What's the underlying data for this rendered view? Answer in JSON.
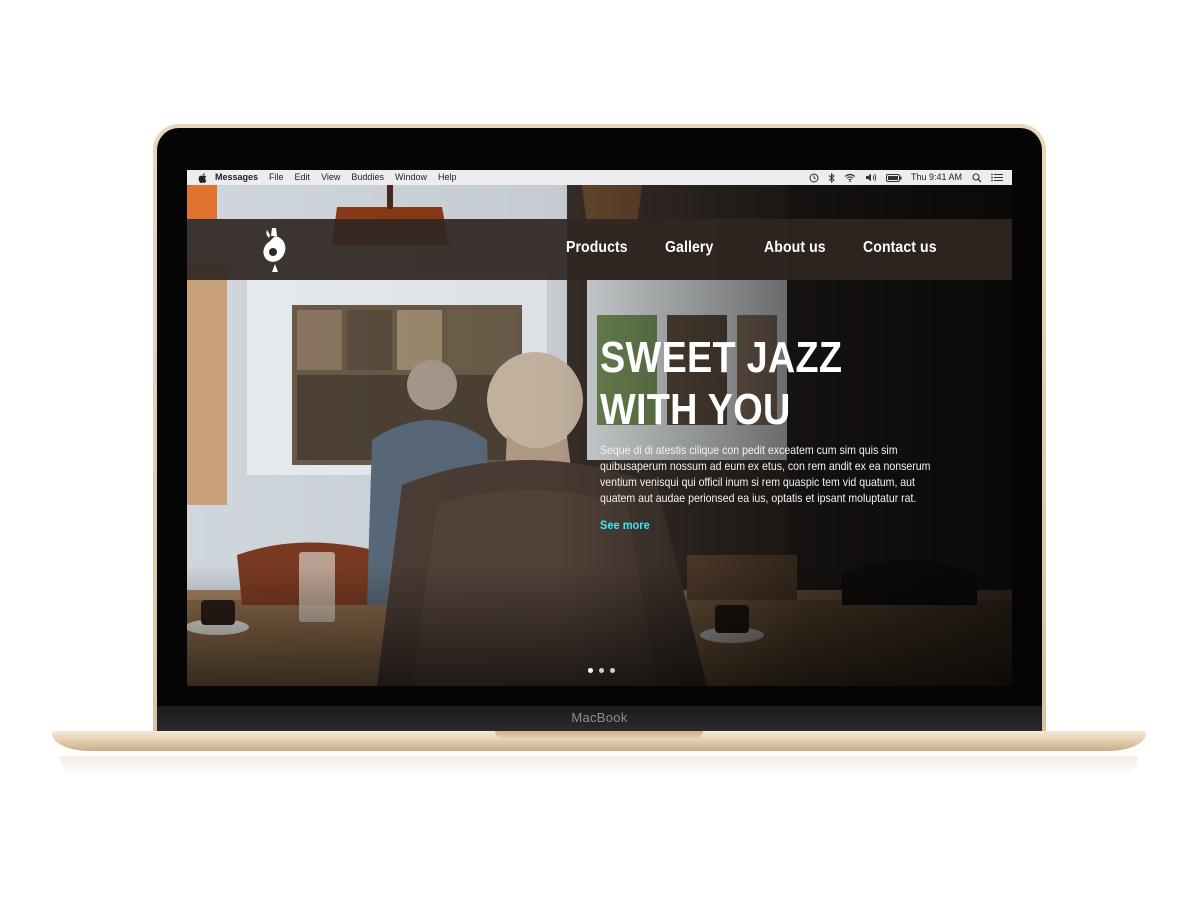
{
  "device": {
    "brand_label": "MacBook"
  },
  "menubar": {
    "app_name": "Messages",
    "menus": [
      "File",
      "Edit",
      "View",
      "Buddies",
      "Window",
      "Help"
    ],
    "clock": "Thu 9:41 AM",
    "status_icons": [
      "time-machine-icon",
      "bluetooth-icon",
      "wifi-icon",
      "volume-icon",
      "battery-icon",
      "spotlight-search-icon",
      "notification-center-icon"
    ]
  },
  "site": {
    "nav": [
      {
        "label": "Products"
      },
      {
        "label": "Gallery"
      },
      {
        "label": "About us"
      },
      {
        "label": "Contact us"
      }
    ],
    "hero": {
      "title_line1": "SWEET JAZZ",
      "title_line2": "WITH YOU",
      "body": "Seque di di atestis cilique con pedit exceatem cum sim quis sim quibusaperum nossum ad eum ex etus, con rem andit ex ea nonserum ventium venisqui qui officil inum si rem quaspic tem vid quatum, aut quatem aut audae perionsed ea ius, optatis et ipsant moluptatur rat.",
      "cta": "See more"
    },
    "carousel": {
      "slides": 3,
      "active": 1
    }
  },
  "colors": {
    "cta": "#3ee6f0",
    "nav_bg": "#302622",
    "laptop_gold": "#e3ccac"
  }
}
